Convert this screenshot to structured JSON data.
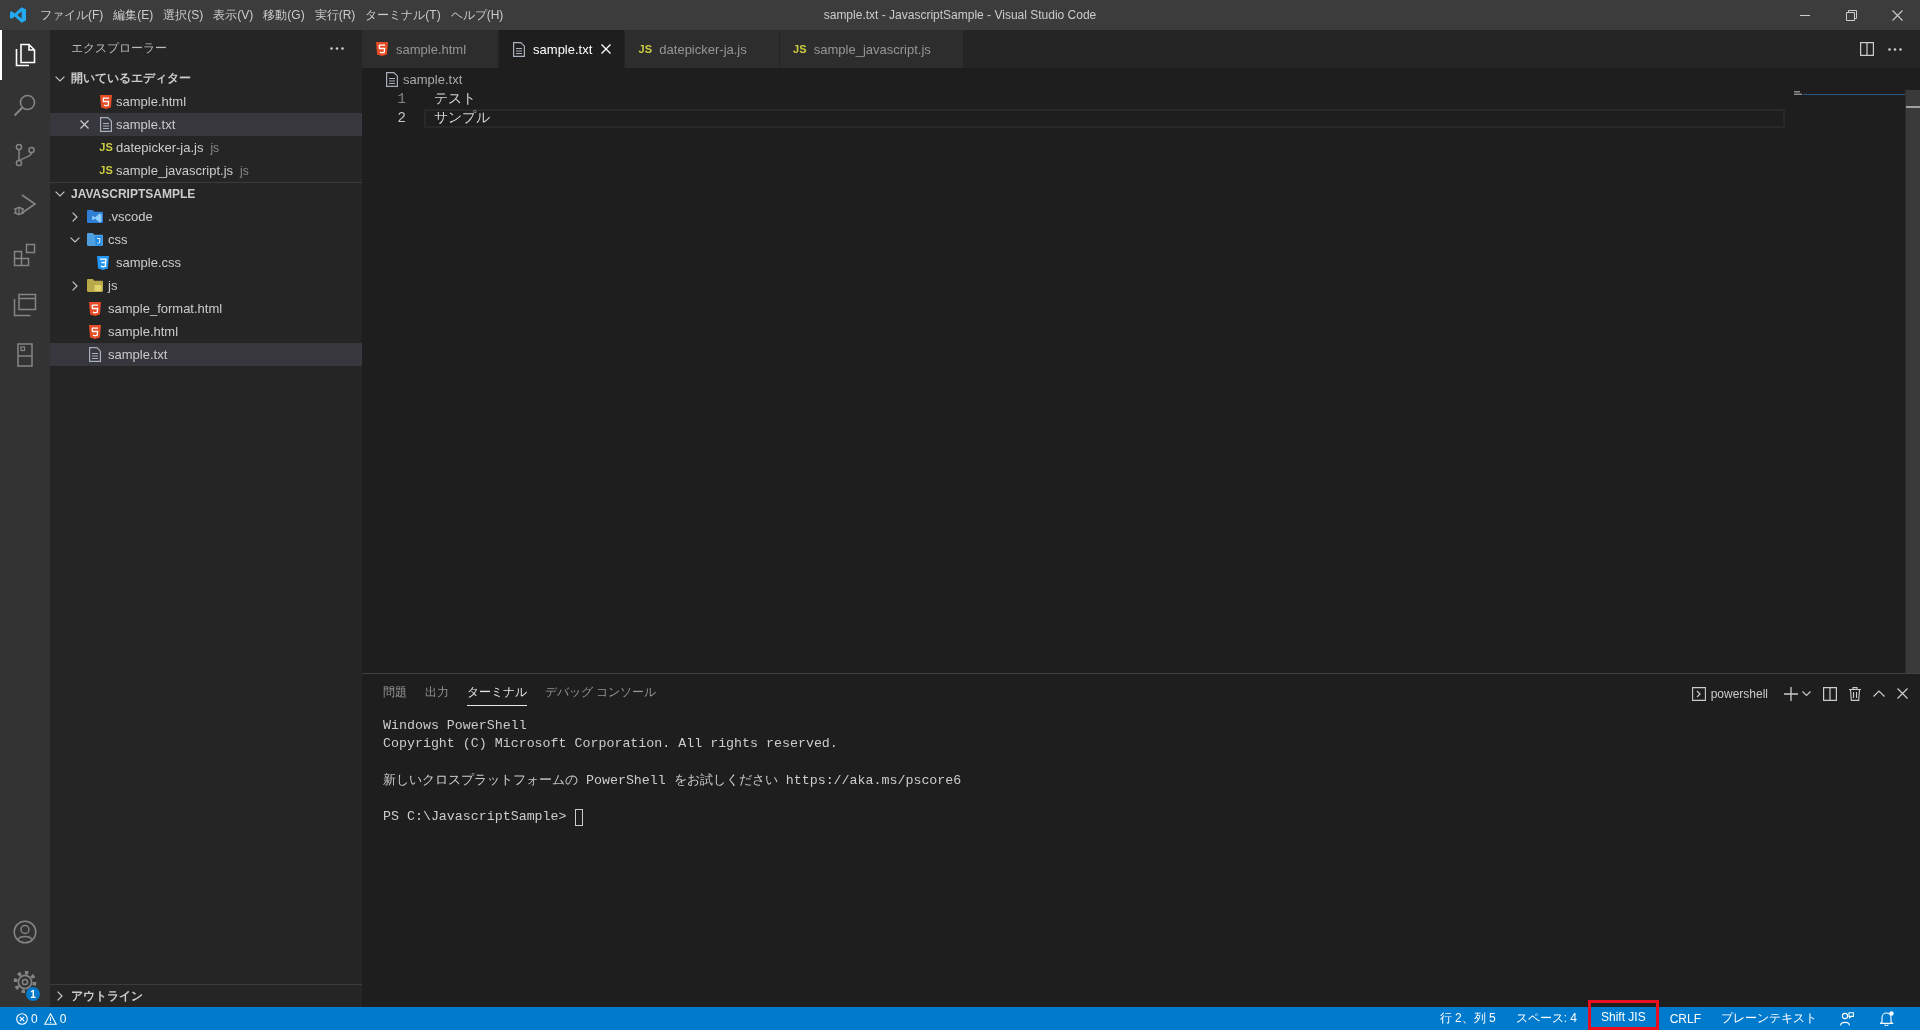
{
  "window": {
    "title": "sample.txt - JavascriptSample - Visual Studio Code",
    "menu": [
      "ファイル(F)",
      "編集(E)",
      "選択(S)",
      "表示(V)",
      "移動(G)",
      "実行(R)",
      "ターミナル(T)",
      "ヘルプ(H)"
    ]
  },
  "activity_bar": {
    "items": [
      {
        "kind": "explorer",
        "selected": true
      },
      {
        "kind": "search",
        "selected": false
      },
      {
        "kind": "source-control",
        "selected": false
      },
      {
        "kind": "run-debug",
        "selected": false
      },
      {
        "kind": "extensions",
        "selected": false
      },
      {
        "kind": "remote-explorer",
        "selected": false
      },
      {
        "kind": "tablet",
        "selected": false
      }
    ],
    "bottom": [
      {
        "kind": "account"
      },
      {
        "kind": "settings",
        "badge": "1"
      }
    ]
  },
  "sidebar": {
    "title": "エクスプローラー",
    "open_editors": {
      "title": "開いているエディター",
      "expanded": true,
      "items": [
        {
          "name": "sample.html",
          "kind": "html",
          "selected": false
        },
        {
          "name": "sample.txt",
          "kind": "txt",
          "selected": true
        },
        {
          "name": "datepicker-ja.js",
          "kind": "js",
          "icon_label": "JS",
          "description": "js",
          "selected": false
        },
        {
          "name": "sample_javascript.js",
          "kind": "js",
          "icon_label": "JS",
          "description": "js",
          "selected": false
        }
      ]
    },
    "folder": {
      "title": "JAVASCRIPTSAMPLE",
      "expanded": true,
      "children": [
        {
          "name": ".vscode",
          "kind": "folder-vscode",
          "expanded": false,
          "selected": false
        },
        {
          "name": "css",
          "kind": "folder-css",
          "expanded": true,
          "selected": false,
          "children": [
            {
              "name": "sample.css",
              "kind": "css",
              "selected": false
            }
          ]
        },
        {
          "name": "js",
          "kind": "folder-js",
          "expanded": false,
          "selected": false
        },
        {
          "name": "sample_format.html",
          "kind": "html",
          "selected": false
        },
        {
          "name": "sample.html",
          "kind": "html",
          "selected": false
        },
        {
          "name": "sample.txt",
          "kind": "txt",
          "selected": true
        }
      ]
    },
    "outline": {
      "title": "アウトライン",
      "expanded": false
    }
  },
  "editor": {
    "tabs": [
      {
        "label": "sample.html",
        "kind": "html",
        "selected": false
      },
      {
        "label": "sample.txt",
        "kind": "txt",
        "selected": true
      },
      {
        "label": "datepicker-ja.js",
        "kind": "js",
        "icon_label": "JS",
        "selected": false
      },
      {
        "label": "sample_javascript.js",
        "kind": "js",
        "icon_label": "JS",
        "selected": false
      }
    ],
    "breadcrumb": {
      "name": "sample.txt",
      "kind": "txt"
    },
    "lines": [
      {
        "number": "1",
        "text": "テスト",
        "current": false
      },
      {
        "number": "2",
        "text": "サンプル",
        "current": true
      }
    ]
  },
  "panel": {
    "tabs": [
      {
        "label": "問題",
        "selected": false
      },
      {
        "label": "出力",
        "selected": false
      },
      {
        "label": "ターミナル",
        "selected": true
      },
      {
        "label": "デバッグ コンソール",
        "selected": false
      }
    ],
    "terminal": {
      "name": "powershell",
      "blocks": [
        [
          "Windows PowerShell",
          "Copyright (C) Microsoft Corporation. All rights reserved."
        ],
        [
          "新しいクロスプラットフォームの PowerShell をお試しください https://aka.ms/pscore6"
        ]
      ],
      "prompt": "PS C:\\JavascriptSample>"
    }
  },
  "status_bar": {
    "errors": "0",
    "warnings": "0",
    "items": [
      {
        "label": "行 2、列 5",
        "highlighted": false
      },
      {
        "label": "スペース: 4",
        "highlighted": false
      },
      {
        "label": "Shift JIS",
        "highlighted": true
      },
      {
        "label": "CRLF",
        "highlighted": false
      },
      {
        "label": "プレーンテキスト",
        "highlighted": false
      }
    ]
  }
}
